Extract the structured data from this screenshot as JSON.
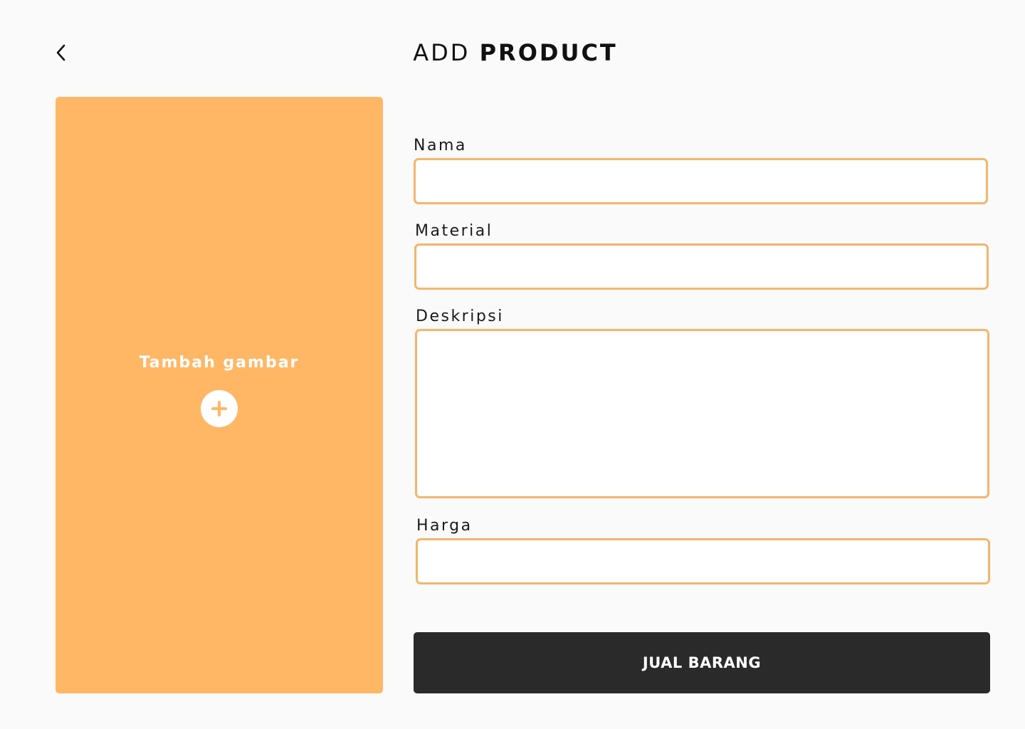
{
  "header": {
    "title_light": "ADD",
    "title_bold": "PRODUCT",
    "back_icon": "chevron-left-icon"
  },
  "upload": {
    "label": "Tambah gambar",
    "add_icon": "plus-icon"
  },
  "form": {
    "nama": {
      "label": "Nama",
      "value": "",
      "placeholder": ""
    },
    "material": {
      "label": "Material",
      "value": "",
      "placeholder": ""
    },
    "deskripsi": {
      "label": "Deskripsi",
      "value": "",
      "placeholder": ""
    },
    "harga": {
      "label": "Harga",
      "value": "",
      "placeholder": ""
    },
    "submit_label": "JUAL BARANG"
  },
  "colors": {
    "accent": "#ffb766",
    "input_border": "#f4b56b",
    "button": "#2a2a2a",
    "background": "#fafafa"
  }
}
